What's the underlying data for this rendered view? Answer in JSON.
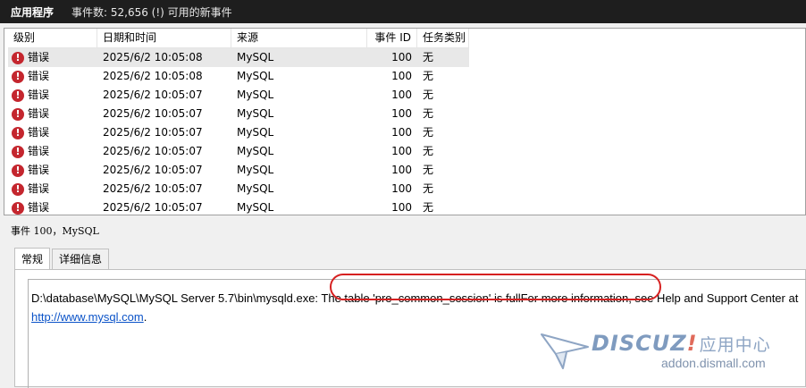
{
  "titlebar": {
    "app_name": "应用程序",
    "event_count": "事件数: 52,656 (!) 可用的新事件"
  },
  "table": {
    "columns": [
      "级别",
      "日期和时间",
      "来源",
      "事件 ID",
      "任务类别"
    ],
    "rows": [
      {
        "level": "错误",
        "datetime": "2025/6/2 10:05:08",
        "source": "MySQL",
        "event_id": "100",
        "category": "无"
      },
      {
        "level": "错误",
        "datetime": "2025/6/2 10:05:08",
        "source": "MySQL",
        "event_id": "100",
        "category": "无"
      },
      {
        "level": "错误",
        "datetime": "2025/6/2 10:05:07",
        "source": "MySQL",
        "event_id": "100",
        "category": "无"
      },
      {
        "level": "错误",
        "datetime": "2025/6/2 10:05:07",
        "source": "MySQL",
        "event_id": "100",
        "category": "无"
      },
      {
        "level": "错误",
        "datetime": "2025/6/2 10:05:07",
        "source": "MySQL",
        "event_id": "100",
        "category": "无"
      },
      {
        "level": "错误",
        "datetime": "2025/6/2 10:05:07",
        "source": "MySQL",
        "event_id": "100",
        "category": "无"
      },
      {
        "level": "错误",
        "datetime": "2025/6/2 10:05:07",
        "source": "MySQL",
        "event_id": "100",
        "category": "无"
      },
      {
        "level": "错误",
        "datetime": "2025/6/2 10:05:07",
        "source": "MySQL",
        "event_id": "100",
        "category": "无"
      },
      {
        "level": "错误",
        "datetime": "2025/6/2 10:05:07",
        "source": "MySQL",
        "event_id": "100",
        "category": "无"
      }
    ],
    "error_icon": "error-icon",
    "error_glyph": "!"
  },
  "detail": {
    "title": "事件 100，MySQL",
    "tabs": [
      "常规",
      "详细信息"
    ],
    "message_line1": "D:\\database\\MySQL\\MySQL Server 5.7\\bin\\mysqld.exe: The table 'pre_common_session' is fullFor more information, see Help and Support Center at",
    "message_link": "http://www.mysql.com",
    "message_suffix": "."
  },
  "watermark": {
    "brand": "DISCUZ",
    "bang": "!",
    "brand_cn": "应用中心",
    "subtitle": "addon.dismall.com"
  },
  "colors": {
    "error_red": "#c4262e",
    "highlight_red": "#d62020",
    "link_blue": "#0b53c8",
    "titlebar_bg": "#1e1e1e"
  }
}
